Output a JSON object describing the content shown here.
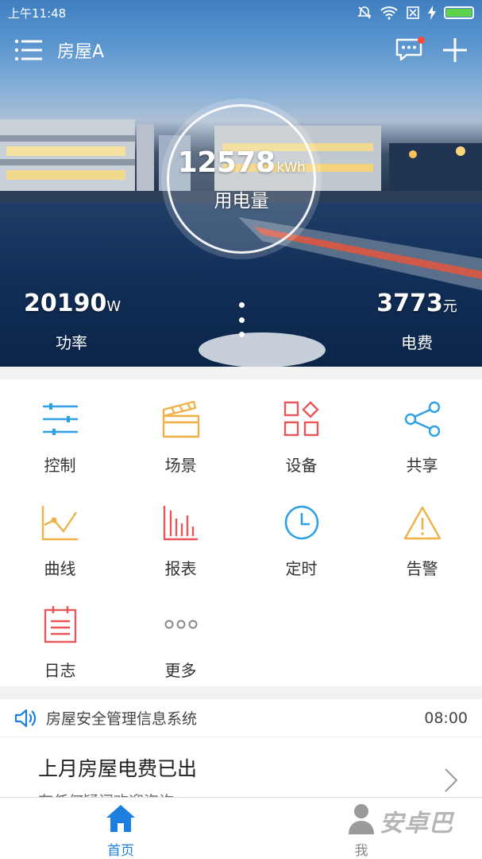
{
  "status_bar": {
    "time": "上午11:48"
  },
  "header": {
    "title": "房屋A"
  },
  "hero": {
    "energy": {
      "value": "12578",
      "unit": "kWh",
      "label": "用电量"
    },
    "power": {
      "value": "20190",
      "unit": "W",
      "label": "功率"
    },
    "cost": {
      "value": "3773",
      "unit": "元",
      "label": "电费"
    }
  },
  "grid": [
    {
      "label": "控制",
      "icon": "sliders-icon"
    },
    {
      "label": "场景",
      "icon": "clapperboard-icon"
    },
    {
      "label": "设备",
      "icon": "devices-grid-icon"
    },
    {
      "label": "共享",
      "icon": "share-icon"
    },
    {
      "label": "曲线",
      "icon": "line-chart-icon"
    },
    {
      "label": "报表",
      "icon": "bar-chart-icon"
    },
    {
      "label": "定时",
      "icon": "clock-icon"
    },
    {
      "label": "告警",
      "icon": "warning-icon"
    },
    {
      "label": "日志",
      "icon": "log-icon"
    },
    {
      "label": "更多",
      "icon": "more-icon"
    }
  ],
  "notice": {
    "text": "房屋安全管理信息系统",
    "time": "08:00"
  },
  "news": {
    "headline": "上月房屋电费已出",
    "subtitle": "有任何疑问欢迎咨询"
  },
  "tabbar": {
    "home": "首页",
    "me": "我"
  },
  "watermark": "安卓巴",
  "colors": {
    "blue": "#2ea0e8",
    "orange": "#f0b14a",
    "red": "#e8565a",
    "active": "#1c7fe0"
  }
}
